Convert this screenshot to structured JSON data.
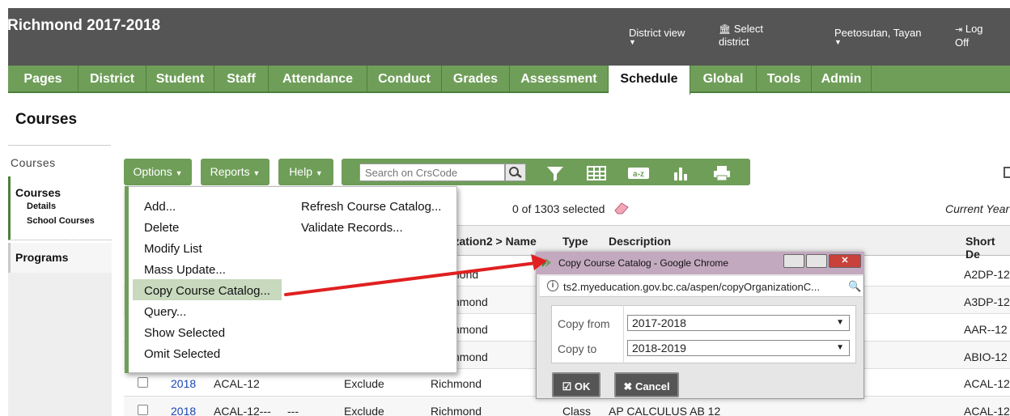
{
  "header": {
    "title": "Richmond 2017-2018",
    "district_view": "District view",
    "select_district": "Select district",
    "user_name": "Peetosutan, Tayan",
    "log_off": "Log Off"
  },
  "nav": {
    "tabs": [
      {
        "label": "Pages"
      },
      {
        "label": "District"
      },
      {
        "label": "Student"
      },
      {
        "label": "Staff"
      },
      {
        "label": "Attendance"
      },
      {
        "label": "Conduct"
      },
      {
        "label": "Grades"
      },
      {
        "label": "Assessment"
      },
      {
        "label": "Schedule"
      },
      {
        "label": "Global"
      },
      {
        "label": "Tools"
      },
      {
        "label": "Admin"
      }
    ],
    "active_tab": "Schedule"
  },
  "page_title": "Courses",
  "sidebar": {
    "heading": "Courses",
    "section": "Courses",
    "sub_items": [
      "Details",
      "School Courses"
    ],
    "programs": "Programs"
  },
  "toolbar": {
    "options_label": "Options",
    "reports_label": "Reports",
    "help_label": "Help",
    "search_placeholder": "Search on CrsCode"
  },
  "selection": {
    "count_text": "0 of 1303 selected",
    "current_year": "Current Year"
  },
  "table": {
    "headers": [
      "nization2 > Name",
      "Type",
      "Description",
      "Short De"
    ],
    "partial_rows": [
      {
        "org": "nond",
        "short": "A2DP-12"
      },
      {
        "org": "hmond",
        "short": "A3DP-12"
      },
      {
        "org": "hmond",
        "short": "AAR--12"
      },
      {
        "org": "hmond",
        "short": "ABIO-12"
      }
    ],
    "full_rows": [
      {
        "year": "2018",
        "code": "ACAL-12",
        "col3": "",
        "status": "Exclude",
        "org": "Richmond",
        "type": "",
        "description": "",
        "short": "ACAL-12"
      },
      {
        "year": "2018",
        "code": "ACAL-12---",
        "col3": "---",
        "status": "Exclude",
        "org": "Richmond",
        "type": "Class",
        "description": "AP CALCULUS AB 12",
        "short": "ACAL-12"
      }
    ]
  },
  "options_menu": {
    "left_items": [
      "Add...",
      "Delete",
      "Modify List",
      "Mass Update...",
      "Copy Course Catalog...",
      "Query...",
      "Show Selected",
      "Omit Selected"
    ],
    "right_items": [
      "Refresh Course Catalog...",
      "Validate Records..."
    ],
    "highlighted": "Copy Course Catalog..."
  },
  "popup": {
    "window_title": "Copy Course Catalog - Google Chrome",
    "url": "ts2.myeducation.gov.bc.ca/aspen/copyOrganizationC...",
    "copy_from_label": "Copy from",
    "copy_from_value": "2017-2018",
    "copy_to_label": "Copy to",
    "copy_to_value": "2018-2019",
    "ok_label": "OK",
    "cancel_label": "Cancel"
  },
  "colors": {
    "header_bg": "#555555",
    "nav_green": "#6f9e59",
    "arrow_red": "#e02020",
    "popup_title": "#c3a9bf"
  }
}
